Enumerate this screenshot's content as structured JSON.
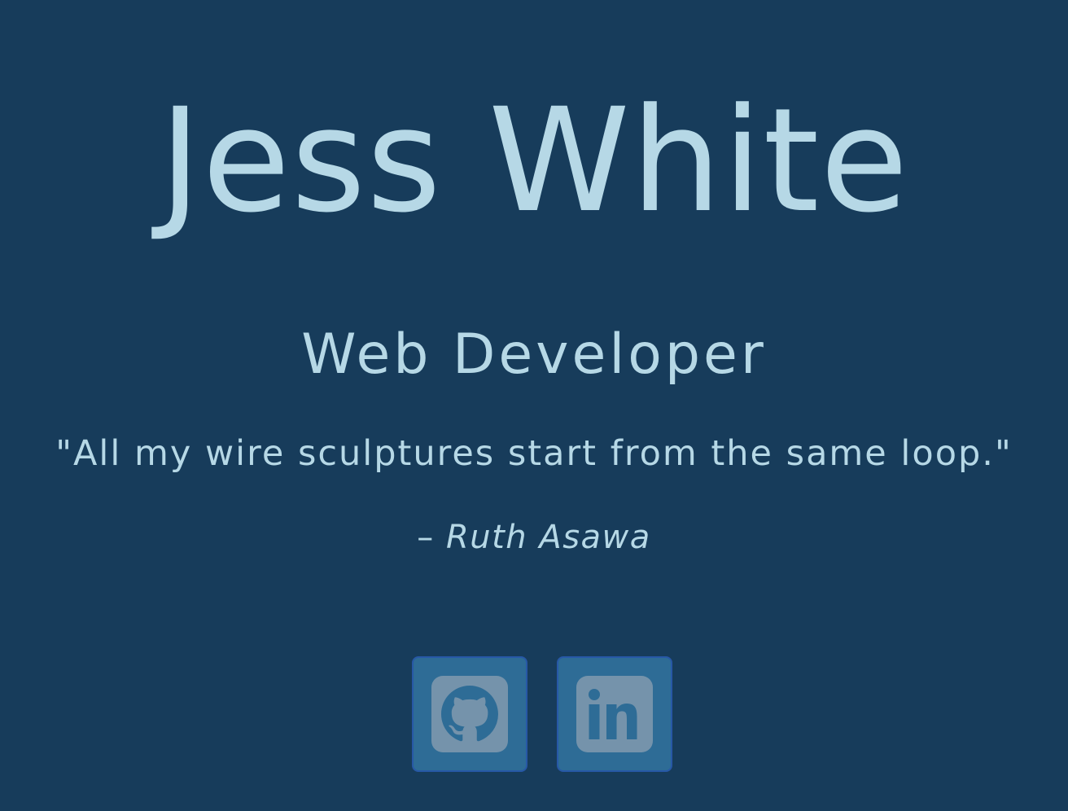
{
  "profile": {
    "name": "Jess White",
    "role": "Web Developer"
  },
  "quote": {
    "text": "\"All my wire sculptures start from the same loop.\"",
    "dash": "–",
    "author": "Ruth Asawa"
  },
  "social": [
    {
      "icon": "github-icon"
    },
    {
      "icon": "linkedin-icon"
    }
  ],
  "colors": {
    "background": "#173c5b",
    "text": "#b6d8e6",
    "button_bg": "#2e6c96",
    "button_border": "#2758a6",
    "icon_fill": "#7593ab"
  }
}
